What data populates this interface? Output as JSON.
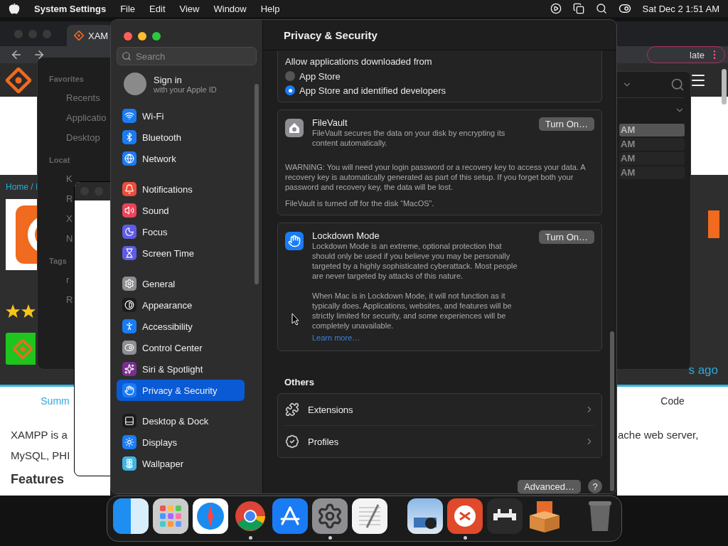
{
  "menu_bar": {
    "app": "System Settings",
    "menus": [
      "File",
      "Edit",
      "View",
      "Window",
      "Help"
    ],
    "clock": "Sat Dec 2  1:51 AM"
  },
  "browser": {
    "tab": "XAM",
    "address_end": "late",
    "left": {
      "breadcrumb": "Home / I",
      "tab": "Summ",
      "lines": [
        "XAMPP is a",
        "MySQL, PHI"
      ],
      "heading": "Features"
    },
    "right": {
      "time": "s ago",
      "tab": "Code",
      "line": "ache web server,"
    }
  },
  "finder": {
    "sections": [
      {
        "heading": "Favorites",
        "items": [
          "Recents",
          "Applicatio",
          "Desktop"
        ]
      },
      {
        "heading": "Locat",
        "items": [
          "K",
          "R",
          "X",
          "N"
        ]
      },
      {
        "heading": "Tags",
        "items": [
          "r",
          "R"
        ]
      }
    ]
  },
  "list_window": {
    "rows": [
      {
        "label": "AM",
        "selected": true
      },
      {
        "label": "AM",
        "selected": false
      },
      {
        "label": "AM",
        "selected": false
      },
      {
        "label": "AM",
        "selected": false
      }
    ]
  },
  "settings": {
    "title": "Privacy & Security",
    "search": {
      "placeholder": "Search"
    },
    "account": {
      "title": "Sign in",
      "subtitle": "with your Apple ID"
    },
    "sidebar": [
      [
        {
          "label": "Wi-Fi",
          "kind": "wifi",
          "color": "#1a7cf5",
          "selected": false
        },
        {
          "label": "Bluetooth",
          "kind": "bluetooth",
          "color": "#1a7cf5",
          "selected": false
        },
        {
          "label": "Network",
          "kind": "globe",
          "color": "#1a7cf5",
          "selected": false
        }
      ],
      [
        {
          "label": "Notifications",
          "kind": "bell",
          "color": "#eb4d3d",
          "selected": false
        },
        {
          "label": "Sound",
          "kind": "speaker",
          "color": "#eb445a",
          "selected": false
        },
        {
          "label": "Focus",
          "kind": "moon",
          "color": "#5e5ce6",
          "selected": false
        },
        {
          "label": "Screen Time",
          "kind": "hourglass",
          "color": "#5e5ce6",
          "selected": false
        }
      ],
      [
        {
          "label": "General",
          "kind": "gear",
          "color": "#8e8e93",
          "selected": false
        },
        {
          "label": "Appearance",
          "kind": "contrast",
          "color": "#1c1c1e",
          "selected": false
        },
        {
          "label": "Accessibility",
          "kind": "person",
          "color": "#1a7cf5",
          "selected": false
        },
        {
          "label": "Control Center",
          "kind": "toggles",
          "color": "#8e8e93",
          "selected": false
        },
        {
          "label": "Siri & Spotlight",
          "kind": "siri",
          "color": "#7a2f8f",
          "selected": false
        },
        {
          "label": "Privacy & Security",
          "kind": "hand",
          "color": "#1a7cf5",
          "selected": true
        }
      ],
      [
        {
          "label": "Desktop & Dock",
          "kind": "dock",
          "color": "#1c1c1e",
          "selected": false
        },
        {
          "label": "Displays",
          "kind": "sun",
          "color": "#1a7cf5",
          "selected": false
        },
        {
          "label": "Wallpaper",
          "kind": "flower",
          "color": "#3fb5e6",
          "selected": false
        }
      ]
    ],
    "downloads": {
      "label": "Allow applications downloaded from",
      "options": [
        {
          "label": "App Store",
          "selected": false
        },
        {
          "label": "App Store and identified developers",
          "selected": true
        }
      ]
    },
    "filevault": {
      "title": "FileVault",
      "description": "FileVault secures the data on your disk by encrypting its content automatically.",
      "button": "Turn On…",
      "warning": "WARNING: You will need your login password or a recovery key to access your data. A recovery key is automatically generated as part of this setup. If you forget both your password and recovery key, the data will be lost.",
      "status": "FileVault is turned off for the disk “MacOS”."
    },
    "lockdown": {
      "title": "Lockdown Mode",
      "paragraphs": [
        "Lockdown Mode is an extreme, optional protection that should only be used if you believe you may be personally targeted by a highly sophisticated cyberattack. Most people are never targeted by attacks of this nature.",
        "When Mac is in Lockdown Mode, it will not function as it typically does. Applications, websites, and features will be strictly limited for security, and some experiences will be completely unavailable."
      ],
      "link": "Learn more…",
      "button": "Turn On…"
    },
    "others": {
      "heading": "Others",
      "items": [
        {
          "label": "Extensions",
          "kind": "extension"
        },
        {
          "label": "Profiles",
          "kind": "profile"
        }
      ]
    },
    "advanced": "Advanced…",
    "help": "?"
  },
  "dock": [
    {
      "kind": "finder",
      "running": false
    },
    {
      "kind": "launchpad",
      "running": false
    },
    {
      "kind": "safari",
      "running": false
    },
    {
      "kind": "chrome",
      "running": true
    },
    {
      "kind": "appstore",
      "running": false
    },
    {
      "kind": "settings",
      "running": true
    },
    {
      "kind": "textedit",
      "running": false
    },
    {
      "kind": "separator"
    },
    {
      "kind": "preview",
      "running": false
    },
    {
      "kind": "remote",
      "running": true
    },
    {
      "kind": "retro",
      "running": false
    },
    {
      "kind": "xampp",
      "running": false
    },
    {
      "kind": "separator"
    },
    {
      "kind": "trash",
      "running": false
    }
  ]
}
